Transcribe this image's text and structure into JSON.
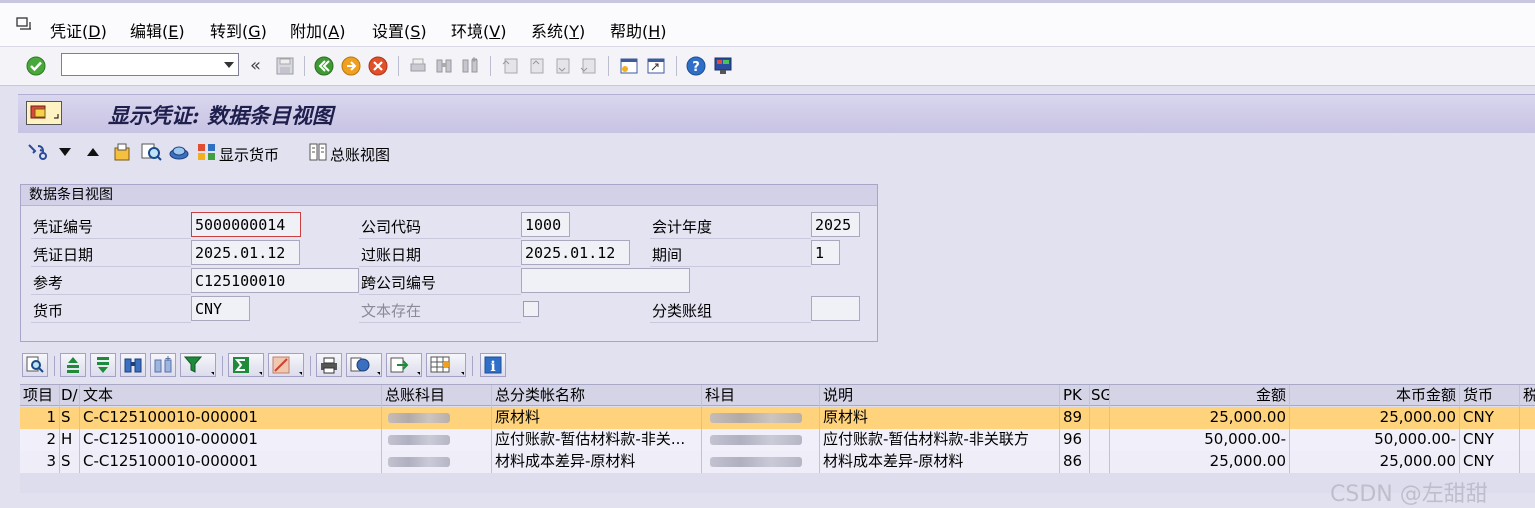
{
  "menubar": {
    "items": [
      {
        "label": "凭证(",
        "key": "D",
        "tail": ")"
      },
      {
        "label": "编辑(",
        "key": "E",
        "tail": ")"
      },
      {
        "label": "转到(",
        "key": "G",
        "tail": ")"
      },
      {
        "label": "附加(",
        "key": "A",
        "tail": ")"
      },
      {
        "label": "设置(",
        "key": "S",
        "tail": ")"
      },
      {
        "label": "环境(",
        "key": "V",
        "tail": ")"
      },
      {
        "label": "系统(",
        "key": "Y",
        "tail": ")"
      },
      {
        "label": "帮助(",
        "key": "H",
        "tail": ")"
      }
    ]
  },
  "toolbar": {
    "command_value": "",
    "expand_glyph": "«"
  },
  "title": "显示凭证: 数据条目视图",
  "apptool": {
    "show_currency": "显示货币",
    "ledger_view": "总账视图"
  },
  "header": {
    "group_title": "数据条目视图",
    "doc_no_label": "凭证编号",
    "doc_no": "5000000014",
    "company_label": "公司代码",
    "company": "1000",
    "fiscal_year_label": "会计年度",
    "fiscal_year": "2025",
    "doc_date_label": "凭证日期",
    "doc_date": "2025.01.12",
    "post_date_label": "过账日期",
    "post_date": "2025.01.12",
    "period_label": "期间",
    "period": "1",
    "ref_label": "参考",
    "ref": "C125100010",
    "cross_co_label": "跨公司编号",
    "cross_co": "",
    "currency_label": "货币",
    "currency": "CNY",
    "text_exists_label": "文本存在",
    "ledger_group_label": "分类账组",
    "ledger_group": ""
  },
  "grid": {
    "columns": [
      "项目",
      "D/",
      "文本",
      "总账科目",
      "总分类帐名称",
      "科目",
      "说明",
      "PK",
      "SG",
      "金额",
      "本币金额",
      "货币",
      "税"
    ],
    "rows": [
      {
        "item": "1",
        "dc": "S",
        "text": "C-C125100010-000001",
        "gl_name": "原材料",
        "desc": "原材料",
        "pk": "89",
        "amount": "25,000.00",
        "local": "25,000.00",
        "cur": "CNY"
      },
      {
        "item": "2",
        "dc": "H",
        "text": "C-C125100010-000001",
        "gl_name": "应付账款-暂估材料款-非关...",
        "desc": "应付账款-暂估材料款-非关联方",
        "pk": "96",
        "amount": "50,000.00-",
        "local": "50,000.00-",
        "cur": "CNY"
      },
      {
        "item": "3",
        "dc": "S",
        "text": "C-C125100010-000001",
        "gl_name": "材料成本差异-原材料",
        "desc": "材料成本差异-原材料",
        "pk": "86",
        "amount": "25,000.00",
        "local": "25,000.00",
        "cur": "CNY"
      }
    ]
  },
  "watermark": "CSDN @左甜甜",
  "colors": {
    "selected_row": "#ffd27c",
    "title_text": "#1f1f4e",
    "bg": "#e2e1f0"
  }
}
